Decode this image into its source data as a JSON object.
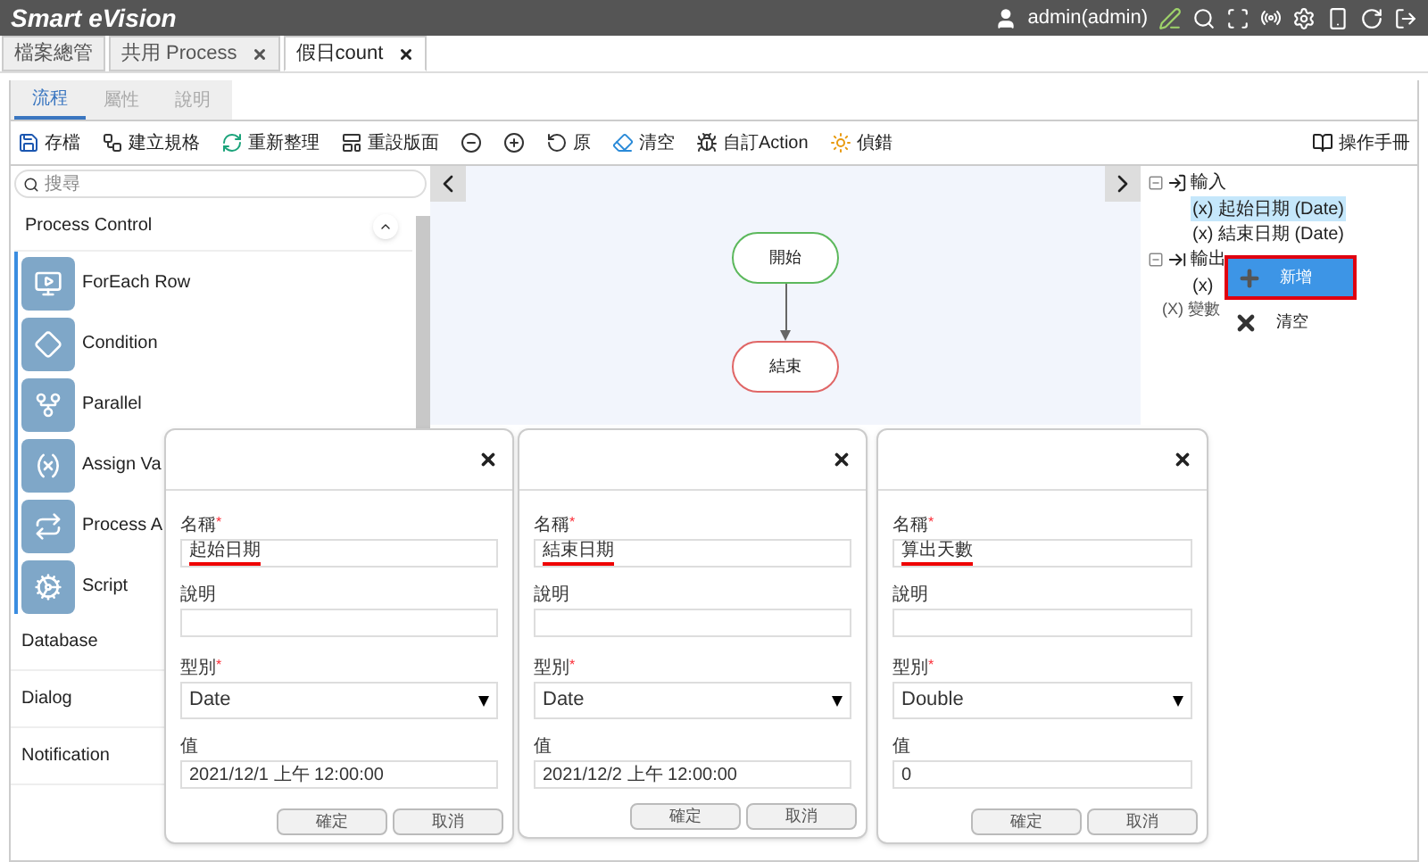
{
  "app": {
    "title": "Smart eVision",
    "user": "admin(admin)"
  },
  "doc_tabs": [
    {
      "label": "檔案總管",
      "closable": false,
      "selected": false
    },
    {
      "label": "共用 Process",
      "closable": true,
      "selected": false
    },
    {
      "label": "假日count",
      "closable": true,
      "selected": true
    }
  ],
  "view_tabs": [
    {
      "label": "流程",
      "selected": true
    },
    {
      "label": "屬性",
      "selected": false
    },
    {
      "label": "說明",
      "selected": false
    }
  ],
  "toolbar": [
    {
      "kind": "save",
      "label": "存檔"
    },
    {
      "kind": "spec",
      "label": "建立規格"
    },
    {
      "kind": "refresh",
      "label": "重新整理"
    },
    {
      "kind": "layout",
      "label": "重設版面"
    },
    {
      "kind": "zoomout"
    },
    {
      "kind": "zoomin"
    },
    {
      "kind": "origin",
      "label": "原"
    },
    {
      "kind": "eraser",
      "label": "清空"
    },
    {
      "kind": "action",
      "label": "自訂Action"
    },
    {
      "kind": "debug",
      "label": "偵錯"
    }
  ],
  "manual_button": "操作手冊",
  "search": {
    "placeholder": "搜尋"
  },
  "palette": {
    "section": "Process Control",
    "expanded": true,
    "items": [
      {
        "kind": "foreach",
        "label": "ForEach Row"
      },
      {
        "kind": "condition",
        "label": "Condition"
      },
      {
        "kind": "parallel",
        "label": "Parallel"
      },
      {
        "kind": "assign",
        "label": "Assign Va"
      },
      {
        "kind": "process",
        "label": "Process A"
      },
      {
        "kind": "script",
        "label": "Script"
      }
    ],
    "collapsed_sections": [
      "Database",
      "Dialog",
      "Notification"
    ]
  },
  "canvas": {
    "nodes": [
      {
        "kind": "start",
        "label": "開始"
      },
      {
        "kind": "end",
        "label": "結束"
      }
    ]
  },
  "tree": [
    {
      "kind": "input",
      "label": "輸入",
      "expanded": true,
      "children": [
        {
          "label": "(x) 起始日期 (Date)",
          "selected": true
        },
        {
          "label": "(x) 結束日期 (Date)",
          "selected": false
        }
      ]
    },
    {
      "kind": "output",
      "label": "輸出",
      "expanded": true,
      "children": [
        {
          "label": "(x)",
          "selected": false
        }
      ]
    },
    {
      "kind": "variable",
      "label": "(X) 變數"
    }
  ],
  "context_menu": [
    {
      "kind": "add",
      "label": "新增",
      "selected": true
    },
    {
      "kind": "clear",
      "label": "清空",
      "selected": false
    }
  ],
  "dialogs": [
    {
      "name_label": "名稱",
      "name_required": "*",
      "name": "起始日期",
      "desc_label": "說明",
      "type_label": "型別",
      "type_required": "*",
      "type": "Date",
      "value_label": "值",
      "value": "2021/12/1 上午 12:00:00",
      "ok": "確定",
      "cancel": "取消"
    },
    {
      "name_label": "名稱",
      "name_required": "*",
      "name": "結束日期",
      "desc_label": "說明",
      "type_label": "型別",
      "type_required": "*",
      "type": "Date",
      "value_label": "值",
      "value": "2021/12/2 上午 12:00:00",
      "ok": "確定",
      "cancel": "取消"
    },
    {
      "name_label": "名稱",
      "name_required": "*",
      "name": "算出天數",
      "desc_label": "說明",
      "type_label": "型別",
      "type_required": "*",
      "type": "Double",
      "value_label": "值",
      "value": "0",
      "ok": "確定",
      "cancel": "取消"
    }
  ]
}
